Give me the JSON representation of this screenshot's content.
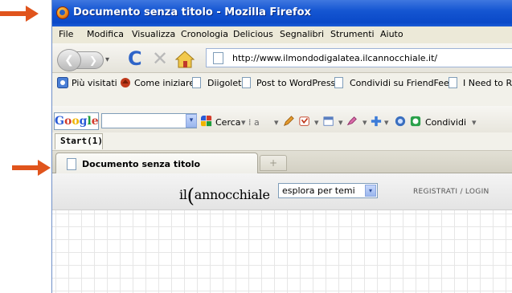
{
  "window": {
    "title": "Documento senza titolo - Mozilla Firefox",
    "icon": "firefox-icon"
  },
  "menu": [
    "File",
    "Modifica",
    "Visualizza",
    "Cronologia",
    "Delicious",
    "Segnalibri",
    "Strumenti",
    "Aiuto"
  ],
  "navigation": {
    "url": "http://www.ilmondodigalatea.ilcannocchiale.it/",
    "reload_glyph": "C",
    "stop_glyph": "✕",
    "back_glyph": "❮",
    "forward_glyph": "❯",
    "history_dropdown_glyph": "▾"
  },
  "bookmarks": [
    "Più visitati",
    "Come iniziare",
    "Diigolet",
    "Post to WordPress",
    "Condividi su FriendFeed",
    "I Need to Re"
  ],
  "google_toolbar": {
    "logo": "Google",
    "dropdown_glyph": "▾",
    "search_label": "Cerca",
    "share_label": "Condividi"
  },
  "start_tab": "Start(1)",
  "tabs": {
    "active": "Documento senza titolo",
    "new_tab_glyph": "+"
  },
  "site": {
    "logo_prefix": "il",
    "logo_bracket": "(",
    "logo_rest": "annocchiale",
    "explore_label": "esplora per temi",
    "explore_glyph": "▾",
    "register": "REGISTRATI / LOGIN"
  },
  "colors": {
    "arrow": "#e0541c",
    "titlebar": "#1556d2",
    "menubar": "#ece9d8"
  }
}
